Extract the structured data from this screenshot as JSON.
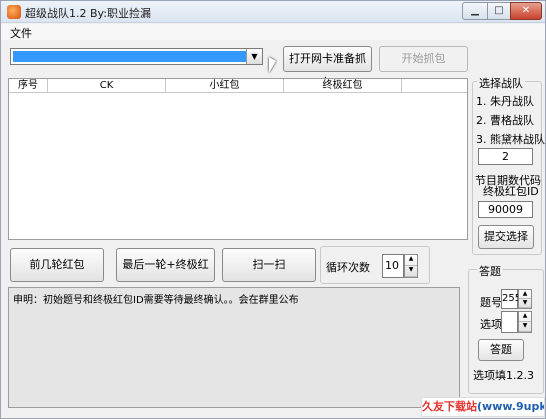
{
  "window": {
    "title": "超级战队1.2 By:职业捡漏"
  },
  "menu": {
    "file": "文件"
  },
  "toolbar": {
    "open_nic_button": "打开网卡准备抓包",
    "start_capture_button": "开始抓包"
  },
  "table": {
    "columns": [
      "序号",
      "CK",
      "小红包",
      "终极红包"
    ]
  },
  "team_panel": {
    "title": "选择战队",
    "options": [
      "1. 朱丹战队",
      "2. 曹格战队",
      "3. 熊黛林战队"
    ],
    "team_value": "2",
    "code_label_line1": "节目期数代码",
    "code_label_line2": "终极红包ID",
    "code_value": "90009",
    "submit_button": "提交选择"
  },
  "actions": {
    "first_rounds_button": "前几轮红包",
    "last_round_button": "最后一轮+终极红包",
    "scan_button": "扫一扫",
    "loop_label": "循环次数",
    "loop_value": "10"
  },
  "answer_panel": {
    "title": "答题",
    "question_label": "题号",
    "question_value": "255",
    "option_label": "选项",
    "answer_button": "答题",
    "hint": "选项填1.2.3"
  },
  "log": {
    "message": "申明：初始题号和终极红包ID需要等待最终确认。。会在群里公布"
  },
  "watermark": {
    "part1": "久友下载站",
    "part2": "(www.9upk.com)"
  }
}
